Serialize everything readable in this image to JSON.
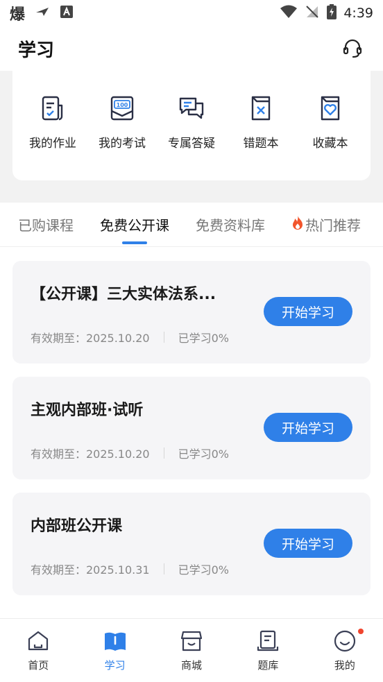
{
  "status_bar": {
    "app_glyph": "爆",
    "time": "4:39"
  },
  "header": {
    "title": "学习"
  },
  "tools": [
    {
      "label": "我的作业",
      "icon": "homework-icon"
    },
    {
      "label": "我的考试",
      "icon": "exam-icon"
    },
    {
      "label": "专属答疑",
      "icon": "qa-chat-icon"
    },
    {
      "label": "错题本",
      "icon": "wrong-questions-icon"
    },
    {
      "label": "收藏本",
      "icon": "favorites-icon"
    }
  ],
  "tabs": [
    {
      "label": "已购课程",
      "active": false
    },
    {
      "label": "免费公开课",
      "active": true
    },
    {
      "label": "免费资料库",
      "active": false
    },
    {
      "label": "热门推荐",
      "active": false,
      "icon": "fire-icon"
    }
  ],
  "courses": [
    {
      "title": "【公开课】三大实体法系...",
      "validity": "有效期至：2025.10.20",
      "progress": "已学习0%",
      "button": "开始学习"
    },
    {
      "title": "主观内部班·试听",
      "validity": "有效期至：2025.10.20",
      "progress": "已学习0%",
      "button": "开始学习"
    },
    {
      "title": "内部班公开课",
      "validity": "有效期至：2025.10.31",
      "progress": "已学习0%",
      "button": "开始学习"
    }
  ],
  "bottom_nav": [
    {
      "label": "首页",
      "icon": "home-icon",
      "active": false
    },
    {
      "label": "学习",
      "icon": "study-book-icon",
      "active": true
    },
    {
      "label": "商城",
      "icon": "store-icon",
      "active": false
    },
    {
      "label": "题库",
      "icon": "question-bank-icon",
      "active": false
    },
    {
      "label": "我的",
      "icon": "profile-smile-icon",
      "active": false,
      "badge": true
    }
  ],
  "colors": {
    "accent": "#2f80e8",
    "badge": "#f0452e",
    "fire": "#f2552c"
  }
}
